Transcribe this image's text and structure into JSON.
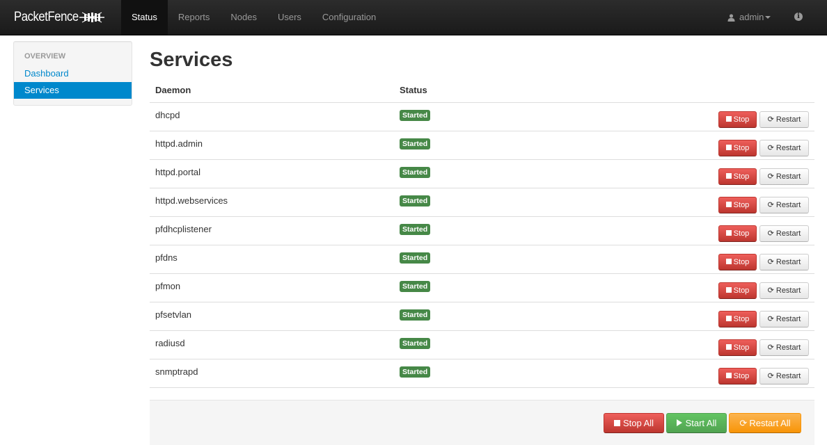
{
  "brand": {
    "name": "PacketFence"
  },
  "nav": {
    "items": [
      {
        "label": "Status"
      },
      {
        "label": "Reports"
      },
      {
        "label": "Nodes"
      },
      {
        "label": "Users"
      },
      {
        "label": "Configuration"
      }
    ],
    "active": "Status",
    "user": "admin"
  },
  "sidebar": {
    "header": "OVERVIEW",
    "items": [
      {
        "label": "Dashboard"
      },
      {
        "label": "Services"
      }
    ],
    "active": "Services"
  },
  "main": {
    "title": "Services",
    "columns": {
      "daemon": "Daemon",
      "status": "Status"
    },
    "rows": [
      {
        "daemon": "dhcpd",
        "status": "Started"
      },
      {
        "daemon": "httpd.admin",
        "status": "Started"
      },
      {
        "daemon": "httpd.portal",
        "status": "Started"
      },
      {
        "daemon": "httpd.webservices",
        "status": "Started"
      },
      {
        "daemon": "pfdhcplistener",
        "status": "Started"
      },
      {
        "daemon": "pfdns",
        "status": "Started"
      },
      {
        "daemon": "pfmon",
        "status": "Started"
      },
      {
        "daemon": "pfsetvlan",
        "status": "Started"
      },
      {
        "daemon": "radiusd",
        "status": "Started"
      },
      {
        "daemon": "snmptrapd",
        "status": "Started"
      }
    ],
    "row_actions": {
      "stop": "Stop",
      "restart": "Restart"
    },
    "actions": {
      "stop_all": "Stop All",
      "start_all": "Start All",
      "restart_all": "Restart All"
    }
  },
  "colors": {
    "navbar": "#1b1b1b",
    "link": "#0088cc",
    "success": "#468847",
    "danger": "#da4f49",
    "start": "#5bb75b",
    "warning": "#faa732"
  }
}
